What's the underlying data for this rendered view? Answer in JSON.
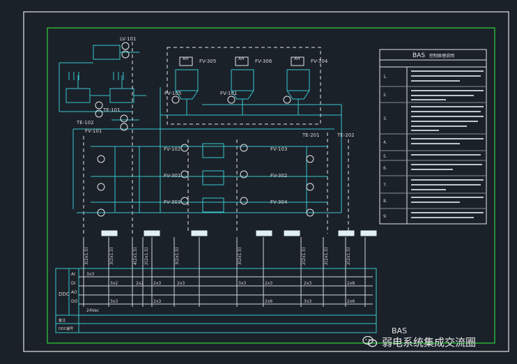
{
  "drawing": {
    "top_labels": [
      "LV-101",
      "TE-101",
      "TE-102",
      "FV-101",
      "TE-201",
      "TE-202"
    ],
    "valve_labels": [
      "FV-101",
      "FV-102",
      "FV-103",
      "FV-104",
      "FV-105",
      "FV-301",
      "FV-302",
      "FV-303",
      "FV-304",
      "FV-305",
      "FV-306"
    ],
    "equipment_labels": [
      "AH",
      "AH",
      "AH"
    ],
    "io_labels": [
      "3(2x1.5)",
      "3(2x1.5)",
      "4(2x1.5)",
      "2(2x1.5)",
      "3(2x1.5)",
      "3(2x1.5)",
      "2(2x1.5)",
      "2(2x1.5)",
      "2(2x1.5)"
    ],
    "ddc_row_labels": [
      "AI",
      "DI",
      "AO",
      "DO"
    ],
    "ddc_title": "DDC",
    "ddc_cells": [
      "3x3",
      "2x2",
      "3x2",
      "2x3",
      "3x3",
      "2x3",
      "2x8",
      "2x6",
      "2x3",
      "2x3",
      "3x3",
      "2x3",
      "2x6",
      "3x3"
    ],
    "ddc_note": "24Vac",
    "ddc_footer": [
      "备注",
      "DDC编号"
    ]
  },
  "legend": {
    "title": "BAS",
    "subtitle": "控制原理说明",
    "rows": [
      "1.",
      "2.",
      "3.",
      "4.",
      "5.",
      "6.",
      "7.",
      "8.",
      "9."
    ]
  },
  "title_block": {
    "text": "BAS"
  },
  "watermark": {
    "text": "弱电系统集成交流圈"
  },
  "colors": {
    "frame": "#ffffff",
    "border": "#2fd23a",
    "cyan": "#37c6d0",
    "label": "#d8d8d8"
  }
}
